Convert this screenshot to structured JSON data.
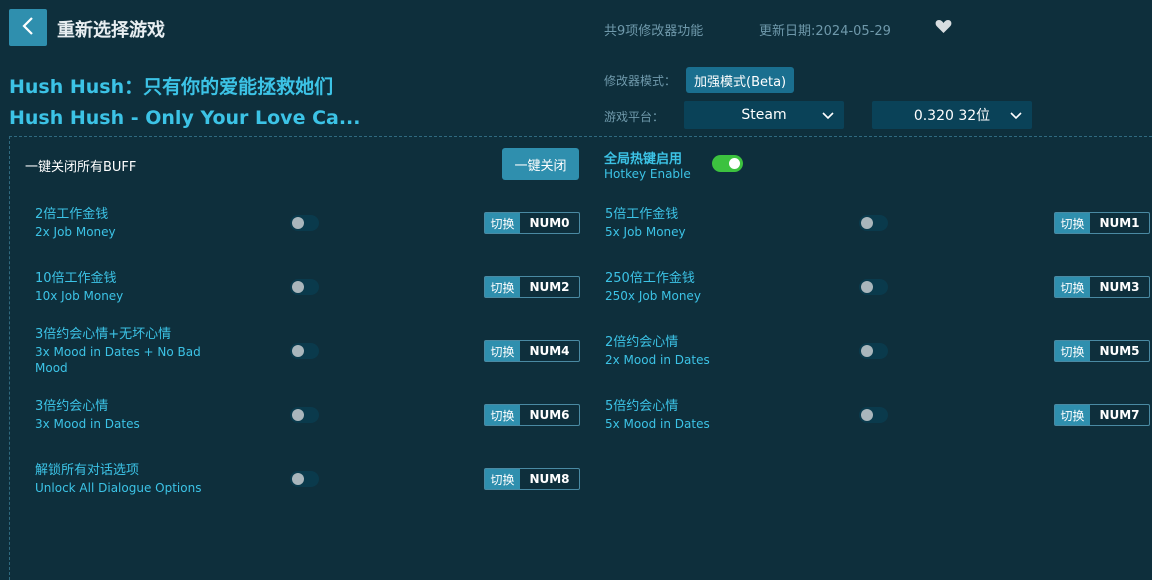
{
  "header": {
    "title": "重新选择游戏",
    "feature_count": "共9项修改器功能",
    "update_date": "更新日期:2024-05-29"
  },
  "game": {
    "title_cn": "Hush Hush：只有你的爱能拯救她们",
    "title_en": "Hush Hush - Only Your Love Ca..."
  },
  "settings": {
    "mode_label": "修改器模式：",
    "mode_value": "加强模式(Beta)",
    "platform_label": "游戏平台：",
    "platform_value": "Steam",
    "version_value": "0.320 32位"
  },
  "controls": {
    "close_all_label": "一键关闭所有BUFF",
    "close_all_button": "一键关闭",
    "hotkey_cn": "全局热键启用",
    "hotkey_en": "Hotkey Enable",
    "hotkey_enabled": true
  },
  "switch_label": "切换",
  "features": [
    {
      "cn": "2倍工作金钱",
      "en": "2x Job Money",
      "key": "NUM0",
      "enabled": false
    },
    {
      "cn": "5倍工作金钱",
      "en": "5x Job Money",
      "key": "NUM1",
      "enabled": false
    },
    {
      "cn": "10倍工作金钱",
      "en": "10x Job Money",
      "key": "NUM2",
      "enabled": false
    },
    {
      "cn": "250倍工作金钱",
      "en": "250x Job Money",
      "key": "NUM3",
      "enabled": false
    },
    {
      "cn": "3倍约会心情+无坏心情",
      "en": "3x Mood in Dates + No Bad Mood",
      "key": "NUM4",
      "enabled": false
    },
    {
      "cn": "2倍约会心情",
      "en": "2x Mood in Dates",
      "key": "NUM5",
      "enabled": false
    },
    {
      "cn": "3倍约会心情",
      "en": "3x Mood in Dates",
      "key": "NUM6",
      "enabled": false
    },
    {
      "cn": "5倍约会心情",
      "en": "5x Mood in Dates",
      "key": "NUM7",
      "enabled": false
    },
    {
      "cn": "解锁所有对话选项",
      "en": "Unlock All Dialogue Options",
      "key": "NUM8",
      "enabled": false
    }
  ]
}
